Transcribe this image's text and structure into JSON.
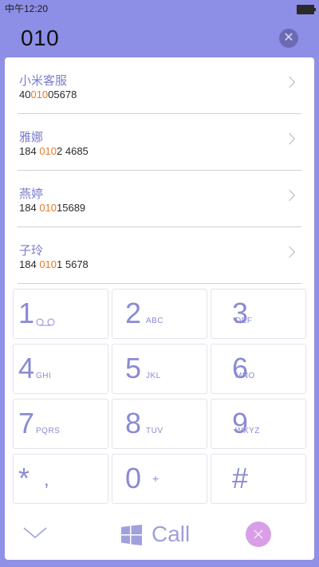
{
  "status_bar": {
    "time": "中午12:20"
  },
  "header": {
    "dialed_number": "010",
    "clear_icon": "close-icon"
  },
  "contacts": [
    {
      "name": "小米客服",
      "number_pre": "40",
      "number_match": "010",
      "number_post": "05678"
    },
    {
      "name": "雅娜",
      "number_pre": "184 ",
      "number_match": "010",
      "number_post": "2 4685"
    },
    {
      "name": "燕婷",
      "number_pre": "184 ",
      "number_match": "010",
      "number_post": "15689"
    },
    {
      "name": "子玲",
      "number_pre": "184 ",
      "number_match": "010",
      "number_post": "1 5678"
    }
  ],
  "keypad": {
    "keys": [
      {
        "digit": "1",
        "letters": ""
      },
      {
        "digit": "2",
        "letters": "ABC"
      },
      {
        "digit": "3",
        "letters": "DEF"
      },
      {
        "digit": "4",
        "letters": "GHI"
      },
      {
        "digit": "5",
        "letters": "JKL"
      },
      {
        "digit": "6",
        "letters": "MNO"
      },
      {
        "digit": "7",
        "letters": "PQRS"
      },
      {
        "digit": "8",
        "letters": "TUV"
      },
      {
        "digit": "9",
        "letters": "WXYZ"
      },
      {
        "digit": "*",
        "letters": ","
      },
      {
        "digit": "0",
        "letters": "+"
      },
      {
        "digit": "#",
        "letters": ""
      }
    ]
  },
  "bottom_bar": {
    "call_label": "Call"
  },
  "colors": {
    "accent": "#8a8bd4",
    "highlight": "#e6792c",
    "header_bg": "#8d8ee6",
    "end_call": "#d99fe6"
  }
}
